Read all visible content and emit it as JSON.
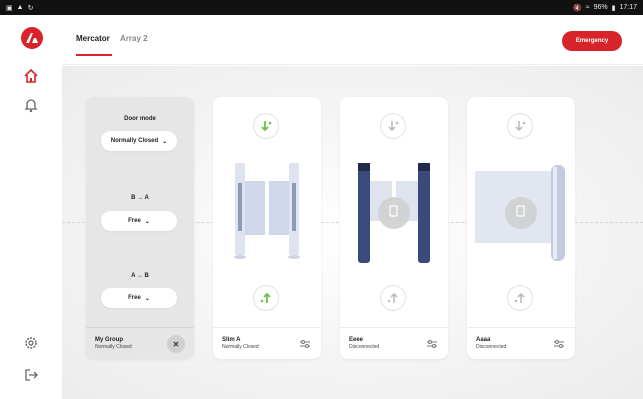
{
  "status_bar": {
    "time": "17:17",
    "battery": "96%"
  },
  "header": {
    "tabs": [
      {
        "label": "Mercator",
        "active": true
      },
      {
        "label": "Array 2",
        "active": false
      }
    ],
    "emergency_label": "Emergency"
  },
  "group_card": {
    "door_mode_label": "Door mode",
    "door_mode_value": "Normally Closed",
    "direction_ba_label": "B → A",
    "direction_ba_value": "Free",
    "direction_ab_label": "A → B",
    "direction_ab_value": "Free",
    "name": "My Group",
    "status": "Normally Closed"
  },
  "devices": [
    {
      "name": "Slim A",
      "status": "Normally Closed"
    },
    {
      "name": "Eeee",
      "status": "Disconnected"
    },
    {
      "name": "Aaaa",
      "status": "Disconnected"
    }
  ],
  "colors": {
    "accent": "#d7232a",
    "green": "#6cc24a",
    "inactive": "#bdbdbd"
  }
}
